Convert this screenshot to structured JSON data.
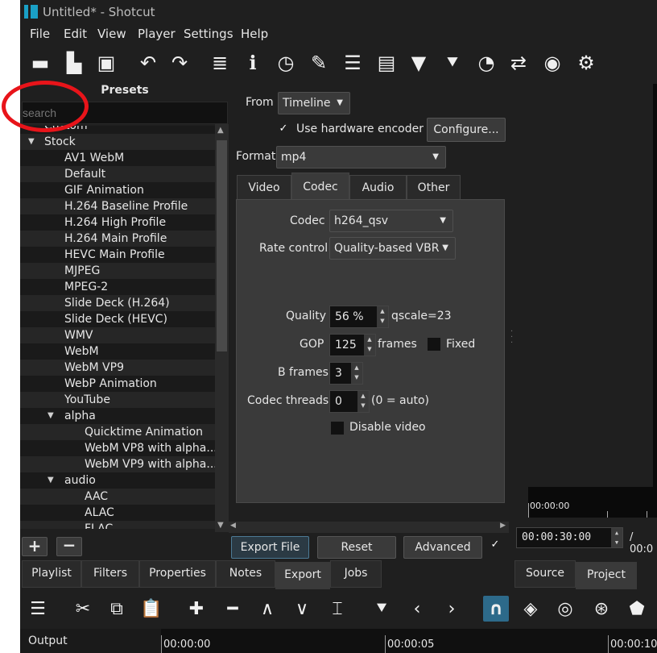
{
  "window": {
    "title": "Untitled* - Shotcut"
  },
  "menu": [
    "File",
    "Edit",
    "View",
    "Player",
    "Settings",
    "Help"
  ],
  "toolbar_icons": [
    "open-icon",
    "open-other-icon",
    "save-icon",
    "undo-icon",
    "redo-icon",
    "audio-peak-meter-icon",
    "properties-icon",
    "history-icon",
    "notes-icon",
    "playlist-icon",
    "timeline-icon",
    "filters-icon",
    "markers-icon",
    "keyframes-icon",
    "subtitles-icon",
    "export-icon",
    "settings-icon"
  ],
  "presets": {
    "title": "Presets",
    "search_placeholder": "search",
    "items": [
      {
        "label": "Custom",
        "indent": 1
      },
      {
        "label": "Stock",
        "indent": 0,
        "expanded": true
      },
      {
        "label": "AV1 WebM",
        "indent": 1
      },
      {
        "label": "Default",
        "indent": 1
      },
      {
        "label": "GIF Animation",
        "indent": 1
      },
      {
        "label": "H.264 Baseline Profile",
        "indent": 1
      },
      {
        "label": "H.264 High Profile",
        "indent": 1
      },
      {
        "label": "H.264 Main Profile",
        "indent": 1
      },
      {
        "label": "HEVC Main Profile",
        "indent": 1
      },
      {
        "label": "MJPEG",
        "indent": 1
      },
      {
        "label": "MPEG-2",
        "indent": 1
      },
      {
        "label": "Slide Deck (H.264)",
        "indent": 1
      },
      {
        "label": "Slide Deck (HEVC)",
        "indent": 1
      },
      {
        "label": "WMV",
        "indent": 1
      },
      {
        "label": "WebM",
        "indent": 1
      },
      {
        "label": "WebM VP9",
        "indent": 1
      },
      {
        "label": "WebP Animation",
        "indent": 1
      },
      {
        "label": "YouTube",
        "indent": 1
      },
      {
        "label": "alpha",
        "indent": 1,
        "expanded": true
      },
      {
        "label": "Quicktime Animation",
        "indent": 2
      },
      {
        "label": "WebM VP8 with alpha...",
        "indent": 2
      },
      {
        "label": "WebM VP9 with alpha...",
        "indent": 2
      },
      {
        "label": "audio",
        "indent": 1,
        "expanded": true
      },
      {
        "label": "AAC",
        "indent": 2
      },
      {
        "label": "ALAC",
        "indent": 2
      },
      {
        "label": "FLAC",
        "indent": 2
      }
    ]
  },
  "export": {
    "from_label": "From",
    "from_value": "Timeline",
    "hw_encoder_label": "Use hardware encoder",
    "hw_encoder_checked": "✓",
    "configure_button": "Configure...",
    "format_label": "Format",
    "format_value": "mp4",
    "tabs": [
      "Video",
      "Codec",
      "Audio",
      "Other"
    ],
    "active_tab": "Codec",
    "codec_label": "Codec",
    "codec_value": "h264_qsv",
    "rate_control_label": "Rate control",
    "rate_control_value": "Quality-based VBR",
    "quality_label": "Quality",
    "quality_value": "56 %",
    "quality_suffix": "qscale=23",
    "gop_label": "GOP",
    "gop_value": "125",
    "gop_suffix": "frames",
    "fixed_label": "Fixed",
    "bframes_label": "B frames",
    "bframes_value": "3",
    "threads_label": "Codec threads",
    "threads_value": "0",
    "threads_suffix": "(0 = auto)",
    "disable_video_label": "Disable video",
    "export_file_button": "Export File",
    "reset_button": "Reset",
    "advanced_button": "Advanced",
    "advanced_checked": "✓"
  },
  "player": {
    "ruler_time": "00:00:00",
    "duration": "00:00:30:00",
    "total_prefix": "/ 00:0"
  },
  "bottom_tabs": [
    "Playlist",
    "Filters",
    "Properties",
    "Notes",
    "Export",
    "Jobs"
  ],
  "player_tabs": [
    "Source",
    "Project"
  ],
  "timeline_toolbar_icons": [
    "menu-icon",
    "cut-icon",
    "copy-icon",
    "paste-icon",
    "append-icon",
    "remove-icon",
    "lift-icon",
    "overwrite-icon",
    "split-icon",
    "marker-icon",
    "previous-marker-icon",
    "next-marker-icon",
    "snap-icon",
    "scrub-icon",
    "ripple-icon",
    "ripple-all-icon",
    "ripple-markers-icon"
  ],
  "timeline": {
    "output_label": "Output",
    "ticks": [
      "00:00:00",
      "00:00:05",
      "00:00:10"
    ]
  }
}
